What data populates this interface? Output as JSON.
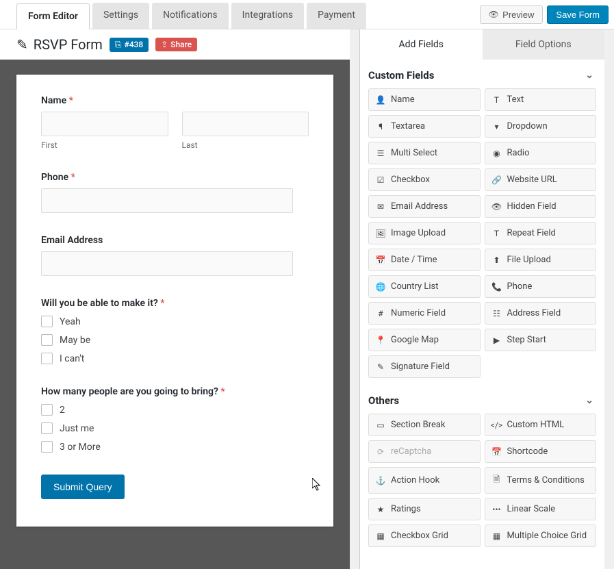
{
  "tabs": {
    "editor": "Form Editor",
    "settings": "Settings",
    "notifications": "Notifications",
    "integrations": "Integrations",
    "payment": "Payment"
  },
  "actions": {
    "preview": "Preview",
    "save": "Save Form"
  },
  "header": {
    "title": "RSVP Form",
    "id_badge": "#438",
    "share": "Share"
  },
  "form": {
    "name": {
      "label": "Name",
      "first": "First",
      "last": "Last"
    },
    "phone": {
      "label": "Phone"
    },
    "email": {
      "label": "Email Address"
    },
    "q1": {
      "label": "Will you be able to make it?",
      "o1": "Yeah",
      "o2": "May be",
      "o3": "I can't"
    },
    "q2": {
      "label": "How many people are you going to bring?",
      "o1": "2",
      "o2": "Just me",
      "o3": "3 or More"
    },
    "submit": "Submit Query"
  },
  "right": {
    "tab_add": "Add Fields",
    "tab_opts": "Field Options",
    "section1": "Custom Fields",
    "f": {
      "name": "Name",
      "text": "Text",
      "textarea": "Textarea",
      "dropdown": "Dropdown",
      "multi": "Multi Select",
      "radio": "Radio",
      "checkbox": "Checkbox",
      "url": "Website URL",
      "emailaddr": "Email Address",
      "hidden": "Hidden Field",
      "image": "Image Upload",
      "repeat": "Repeat Field",
      "datetime": "Date / Time",
      "fileup": "File Upload",
      "country": "Country List",
      "phone": "Phone",
      "numeric": "Numeric Field",
      "address": "Address Field",
      "gmap": "Google Map",
      "step": "Step Start",
      "signature": "Signature Field"
    },
    "section2": "Others",
    "o": {
      "section": "Section Break",
      "html": "Custom HTML",
      "recaptcha": "reCaptcha",
      "shortcode": "Shortcode",
      "action": "Action Hook",
      "terms": "Terms & Conditions",
      "ratings": "Ratings",
      "linear": "Linear Scale",
      "cbgrid": "Checkbox Grid",
      "mcgrid": "Multiple Choice Grid"
    }
  }
}
